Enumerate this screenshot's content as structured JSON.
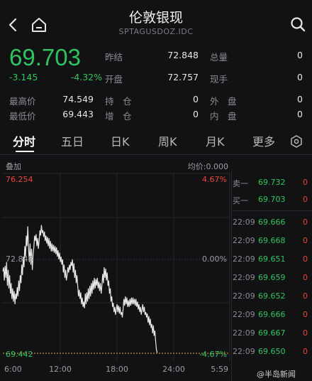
{
  "header": {
    "title": "伦敦银现",
    "subtitle": "SPTAGUSDOZ.IDC",
    "back_icon": "chevron-left-icon",
    "home_icon": "home-icon",
    "search_icon": "search-icon"
  },
  "quote": {
    "price": "69.703",
    "change": "-3.145",
    "change_pct": "-4.32%",
    "prev_close_label": "昨结",
    "prev_close": "72.848",
    "open_label": "开盘",
    "open": "72.757",
    "total_vol_label": "总量",
    "total_vol": "0",
    "current_vol_label": "现手",
    "current_vol": "0",
    "high_label": "最高价",
    "high": "74.549",
    "low_label": "最低价",
    "low": "69.443",
    "position_label": "持　仓",
    "position": "0",
    "increase_label": "增　仓",
    "increase": "0",
    "outer_label": "外　盘",
    "outer": "0",
    "inner_label": "内　盘",
    "inner": "0"
  },
  "tabs": [
    "分时",
    "五日",
    "日K",
    "周K",
    "月K",
    "更多"
  ],
  "tabs_settings_icon": "hexagon-settings-icon",
  "chart_header": {
    "left": "叠加",
    "right": "均价:0.000"
  },
  "chart_labels": {
    "top_price": "76.254",
    "top_pct": "4.67%",
    "mid_price": "72.848",
    "mid_pct": "0.00%",
    "bottom_price": "69.442",
    "bottom_pct": "-4.67%"
  },
  "chart_data": {
    "type": "line",
    "x_ticks": [
      "6:00",
      "12:00",
      "18:00",
      "24:00",
      "5:59"
    ],
    "ylim": [
      69.442,
      76.254
    ],
    "reference": 72.848,
    "colors": {
      "line": "#e8e8e8",
      "reference": "#e8a93a"
    },
    "points": [
      [
        0,
        72.55
      ],
      [
        1,
        72.7
      ],
      [
        2,
        72.2
      ],
      [
        3,
        72.75
      ],
      [
        4,
        72.3
      ],
      [
        5,
        72.9
      ],
      [
        6,
        72.0
      ],
      [
        7,
        72.6
      ],
      [
        8,
        71.9
      ],
      [
        9,
        72.4
      ],
      [
        10,
        71.7
      ],
      [
        11,
        72.1
      ],
      [
        12,
        71.5
      ],
      [
        13,
        71.9
      ],
      [
        14,
        71.4
      ],
      [
        15,
        71.8
      ],
      [
        16,
        71.3
      ],
      [
        17,
        71.7
      ],
      [
        18,
        71.5
      ],
      [
        19,
        71.95
      ],
      [
        20,
        71.6
      ],
      [
        21,
        72.2
      ],
      [
        22,
        71.8
      ],
      [
        23,
        72.4
      ],
      [
        24,
        72.1
      ],
      [
        25,
        72.8
      ],
      [
        26,
        72.4
      ],
      [
        27,
        73.1
      ],
      [
        28,
        72.7
      ],
      [
        29,
        73.5
      ],
      [
        30,
        73.1
      ],
      [
        31,
        73.9
      ],
      [
        32,
        73.5
      ],
      [
        33,
        74.25
      ],
      [
        34,
        73.4
      ],
      [
        35,
        72.9
      ],
      [
        36,
        73.6
      ],
      [
        37,
        72.8
      ],
      [
        38,
        73.4
      ],
      [
        39,
        72.6
      ],
      [
        40,
        73.2
      ],
      [
        41,
        73.45
      ],
      [
        42,
        73.9
      ],
      [
        43,
        73.7
      ],
      [
        44,
        73.95
      ],
      [
        45,
        73.5
      ],
      [
        46,
        73.8
      ],
      [
        47,
        73.4
      ],
      [
        48,
        73.7
      ],
      [
        49,
        74.1
      ],
      [
        50,
        73.9
      ],
      [
        51,
        74.3
      ],
      [
        52,
        74.0
      ],
      [
        53,
        74.1
      ],
      [
        54,
        73.85
      ],
      [
        55,
        74.05
      ],
      [
        56,
        73.7
      ],
      [
        57,
        73.9
      ],
      [
        58,
        73.6
      ],
      [
        59,
        73.85
      ],
      [
        60,
        73.5
      ],
      [
        61,
        73.8
      ],
      [
        62,
        73.4
      ],
      [
        63,
        73.7
      ],
      [
        64,
        73.3
      ],
      [
        65,
        73.6
      ],
      [
        66,
        73.3
      ],
      [
        67,
        73.55
      ],
      [
        68,
        73.25
      ],
      [
        69,
        73.5
      ],
      [
        70,
        73.2
      ],
      [
        71,
        73.45
      ],
      [
        72,
        73.1
      ],
      [
        73,
        73.35
      ],
      [
        74,
        73.0
      ],
      [
        75,
        73.25
      ],
      [
        76,
        72.9
      ],
      [
        77,
        73.1
      ],
      [
        78,
        72.8
      ],
      [
        79,
        73.0
      ],
      [
        80,
        72.5
      ],
      [
        81,
        72.8
      ],
      [
        82,
        72.3
      ],
      [
        83,
        72.6
      ],
      [
        84,
        72.2
      ],
      [
        85,
        72.4
      ],
      [
        86,
        72.7
      ],
      [
        87,
        72.5
      ],
      [
        88,
        72.8
      ],
      [
        89,
        72.6
      ],
      [
        90,
        72.9
      ],
      [
        91,
        72.75
      ],
      [
        92,
        73.0
      ],
      [
        93,
        72.5
      ],
      [
        94,
        72.85
      ],
      [
        95,
        72.3
      ],
      [
        96,
        72.6
      ],
      [
        97,
        72.1
      ],
      [
        98,
        72.4
      ],
      [
        99,
        72.0
      ],
      [
        100,
        71.6
      ],
      [
        101,
        71.85
      ],
      [
        102,
        71.5
      ],
      [
        103,
        71.75
      ],
      [
        104,
        71.3
      ],
      [
        105,
        71.55
      ],
      [
        106,
        71.2
      ],
      [
        107,
        71.4
      ],
      [
        108,
        71.15
      ],
      [
        109,
        71.7
      ],
      [
        110,
        71.3
      ],
      [
        111,
        71.75
      ],
      [
        112,
        71.4
      ],
      [
        113,
        71.9
      ],
      [
        114,
        71.5
      ],
      [
        115,
        72.0
      ],
      [
        116,
        71.6
      ],
      [
        117,
        72.1
      ],
      [
        118,
        71.7
      ],
      [
        119,
        72.2
      ],
      [
        120,
        71.85
      ],
      [
        121,
        72.3
      ],
      [
        122,
        71.9
      ],
      [
        123,
        72.25
      ],
      [
        124,
        72.0
      ],
      [
        125,
        72.3
      ],
      [
        126,
        71.9
      ],
      [
        127,
        72.15
      ],
      [
        128,
        71.8
      ],
      [
        129,
        72.1
      ],
      [
        130,
        71.7
      ],
      [
        131,
        72.0
      ],
      [
        132,
        72.45
      ],
      [
        133,
        72.1
      ],
      [
        134,
        72.7
      ],
      [
        135,
        72.3
      ],
      [
        136,
        72.65
      ],
      [
        137,
        72.2
      ],
      [
        138,
        72.5
      ],
      [
        139,
        72.0
      ],
      [
        140,
        72.2
      ],
      [
        141,
        71.7
      ],
      [
        142,
        71.9
      ],
      [
        143,
        71.4
      ],
      [
        144,
        71.6
      ],
      [
        145,
        71.2
      ],
      [
        146,
        71.35
      ],
      [
        147,
        71.0
      ],
      [
        148,
        71.2
      ],
      [
        149,
        70.9
      ],
      [
        150,
        71.1
      ],
      [
        151,
        71.3
      ],
      [
        152,
        71.0
      ],
      [
        153,
        71.25
      ],
      [
        154,
        70.95
      ],
      [
        155,
        71.2
      ],
      [
        156,
        70.9
      ],
      [
        157,
        71.0
      ],
      [
        158,
        70.8
      ],
      [
        159,
        71.1
      ],
      [
        160,
        71.5
      ],
      [
        161,
        71.25
      ],
      [
        162,
        71.6
      ],
      [
        163,
        71.3
      ],
      [
        164,
        71.55
      ],
      [
        165,
        71.2
      ],
      [
        166,
        71.45
      ],
      [
        167,
        71.2
      ],
      [
        168,
        71.5
      ],
      [
        169,
        71.25
      ],
      [
        170,
        71.55
      ],
      [
        171,
        71.3
      ],
      [
        172,
        71.55
      ],
      [
        173,
        71.3
      ],
      [
        174,
        71.5
      ],
      [
        175,
        71.25
      ],
      [
        176,
        71.5
      ],
      [
        177,
        71.2
      ],
      [
        178,
        71.4
      ],
      [
        179,
        71.1
      ],
      [
        180,
        71.3
      ],
      [
        181,
        71.0
      ],
      [
        182,
        71.2
      ],
      [
        183,
        70.9
      ],
      [
        184,
        71.1
      ],
      [
        185,
        71.3
      ],
      [
        186,
        71.0
      ],
      [
        187,
        71.2
      ],
      [
        188,
        70.9
      ],
      [
        189,
        71.0
      ],
      [
        190,
        70.8
      ],
      [
        191,
        70.95
      ],
      [
        192,
        70.6
      ],
      [
        193,
        70.85
      ],
      [
        194,
        70.5
      ],
      [
        195,
        70.75
      ],
      [
        196,
        70.4
      ],
      [
        197,
        70.55
      ],
      [
        198,
        70.2
      ],
      [
        199,
        70.5
      ],
      [
        200,
        70.1
      ],
      [
        201,
        70.3
      ],
      [
        202,
        69.9
      ],
      [
        203,
        69.6
      ],
      [
        204,
        69.46
      ]
    ],
    "x_total": 300
  },
  "order_book": {
    "sell_label": "卖一",
    "sell_price": "69.732",
    "sell_vol": "0",
    "buy_label": "买一",
    "buy_price": "69.703",
    "buy_vol": "0",
    "trades": [
      {
        "time": "22:09",
        "price": "69.666",
        "vol": "0"
      },
      {
        "time": "22:09",
        "price": "69.668",
        "vol": "0"
      },
      {
        "time": "22:09",
        "price": "69.651",
        "vol": "0"
      },
      {
        "time": "22:09",
        "price": "69.659",
        "vol": "0"
      },
      {
        "time": "22:09",
        "price": "69.652",
        "vol": "0"
      },
      {
        "time": "22:09",
        "price": "69.666",
        "vol": "0"
      },
      {
        "time": "22:09",
        "price": "69.667",
        "vol": "0"
      },
      {
        "time": "22:09",
        "price": "69.650",
        "vol": "0"
      }
    ]
  },
  "watermark": "@半岛新闻"
}
